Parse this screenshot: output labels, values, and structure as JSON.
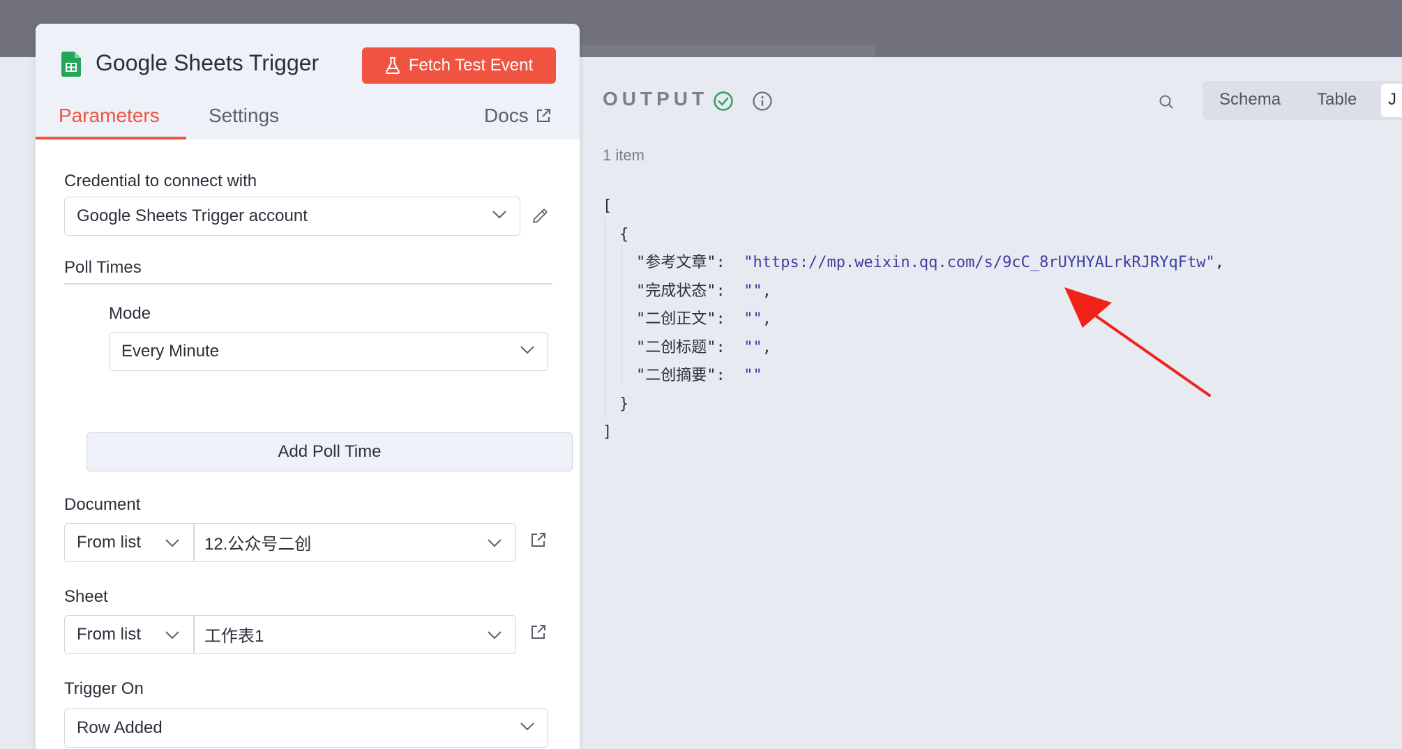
{
  "node": {
    "title": "Google Sheets Trigger",
    "fetch_button": "Fetch Test Event",
    "tabs": {
      "parameters": "Parameters",
      "settings": "Settings",
      "docs": "Docs"
    }
  },
  "form": {
    "credential_label": "Credential to connect with",
    "credential_value": "Google Sheets Trigger account",
    "poll_times_label": "Poll Times",
    "mode_label": "Mode",
    "mode_value": "Every Minute",
    "add_poll_time": "Add Poll Time",
    "document_label": "Document",
    "document_source": "From list",
    "document_value": "12.公众号二创",
    "sheet_label": "Sheet",
    "sheet_source": "From list",
    "sheet_value": "工作表1",
    "trigger_on_label": "Trigger On",
    "trigger_on_value": "Row Added"
  },
  "output": {
    "title": "OUTPUT",
    "views": {
      "schema": "Schema",
      "table": "Table",
      "json": "J"
    },
    "item_count": "1 item",
    "json": {
      "open_bracket": "[",
      "open_brace": "{",
      "rows": [
        {
          "key": "\"参考文章\":",
          "value": "\"https://mp.weixin.qq.com/s/9cC_8rUYHYALrkRJRYqFtw\"",
          "comma": ","
        },
        {
          "key": "\"完成状态\":",
          "value": "\"\"",
          "comma": ","
        },
        {
          "key": "\"二创正文\":",
          "value": "\"\"",
          "comma": ","
        },
        {
          "key": "\"二创标题\":",
          "value": "\"\"",
          "comma": ","
        },
        {
          "key": "\"二创摘要\":",
          "value": "\"\"",
          "comma": ""
        }
      ],
      "close_brace": "}",
      "close_bracket": "]"
    }
  },
  "colors": {
    "accent": "#f0533f",
    "success": "#2f9e63",
    "json_string": "#3b3fa0",
    "annotation_arrow": "#f0231b"
  },
  "icons": [
    "google-sheets-icon",
    "flask-icon",
    "external-link-icon",
    "pencil-icon",
    "chevron-down-icon",
    "check-circle-icon",
    "info-icon",
    "search-icon"
  ]
}
